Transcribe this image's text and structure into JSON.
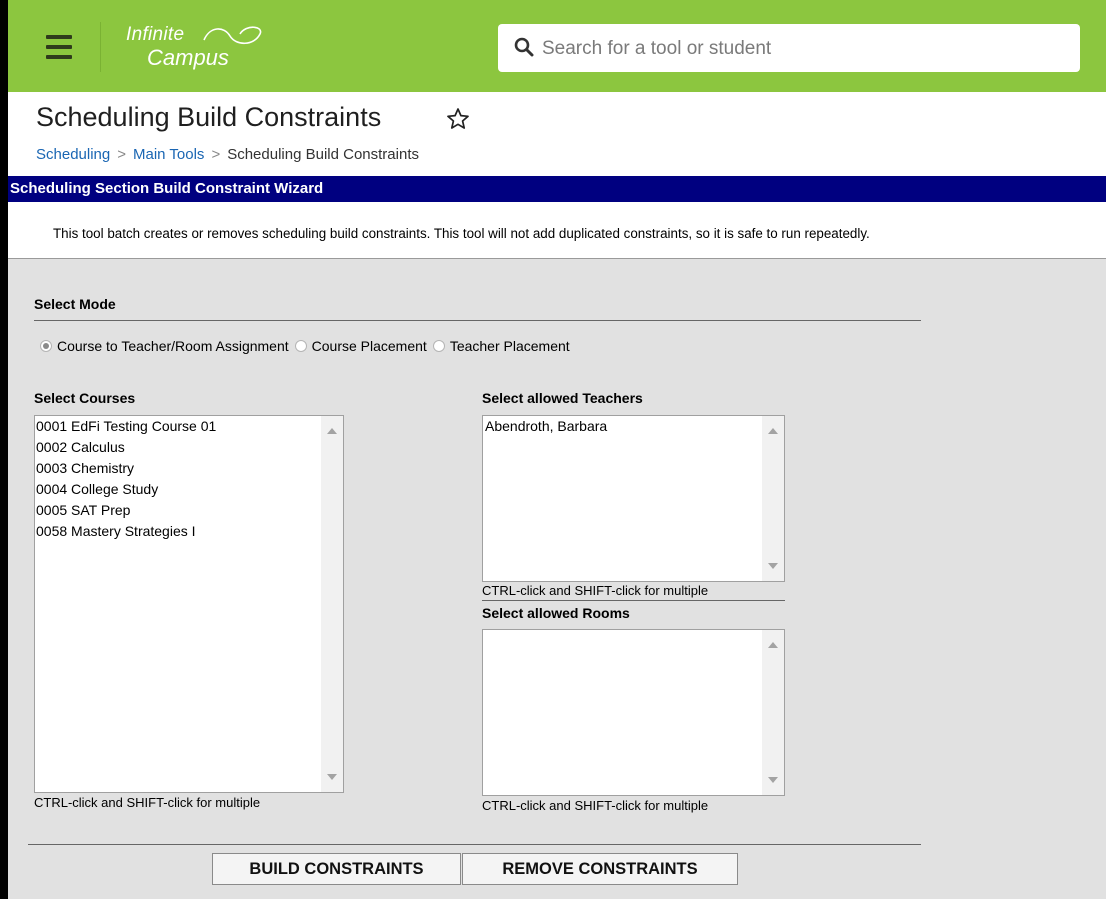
{
  "header": {
    "logo_line1": "Infinite",
    "logo_line2": "Campus",
    "search_placeholder": "Search for a tool or student"
  },
  "page": {
    "title": "Scheduling Build Constraints",
    "breadcrumb": [
      "Scheduling",
      "Main Tools",
      "Scheduling Build Constraints"
    ]
  },
  "wizard": {
    "title": "Scheduling Section Build Constraint Wizard",
    "description": "This tool batch creates or removes scheduling build constraints. This tool will not add duplicated constraints, so it is safe to run repeatedly."
  },
  "mode": {
    "label": "Select Mode",
    "options": [
      {
        "label": "Course to Teacher/Room Assignment",
        "selected": true
      },
      {
        "label": "Course Placement",
        "selected": false
      },
      {
        "label": "Teacher Placement",
        "selected": false
      }
    ]
  },
  "courses": {
    "label": "Select Courses",
    "items": [
      "0001 EdFi Testing Course 01",
      "0002 Calculus",
      "0003 Chemistry",
      "0004 College Study",
      "0005 SAT Prep",
      "0058 Mastery Strategies I"
    ],
    "hint": "CTRL-click and SHIFT-click for multiple"
  },
  "teachers": {
    "label": "Select allowed Teachers",
    "items": [
      "Abendroth, Barbara"
    ],
    "hint": "CTRL-click and SHIFT-click for multiple"
  },
  "rooms": {
    "label": "Select allowed Rooms",
    "items": [],
    "hint": "CTRL-click and SHIFT-click for multiple"
  },
  "actions": {
    "build_label": "BUILD CONSTRAINTS",
    "remove_label": "REMOVE CONSTRAINTS"
  },
  "colors": {
    "header_green": "#8cc63f",
    "wizard_bar": "#000080",
    "link_blue": "#1a66b3",
    "content_gray": "#e1e1e1"
  }
}
